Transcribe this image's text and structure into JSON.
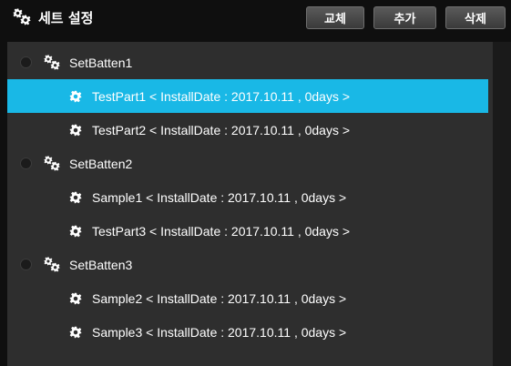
{
  "header": {
    "title": "세트 설정",
    "title_icon": "gears-icon",
    "buttons": {
      "replace": "교체",
      "add": "추가",
      "delete": "삭제"
    }
  },
  "colors": {
    "selected_row": "#19b8e6",
    "panel_bg": "#2e2e2e",
    "page_bg": "#0f0f0f"
  },
  "groups": [
    {
      "label": "SetBatten1",
      "items": [
        {
          "label": "TestPart1 < InstallDate : 2017.10.11 , 0days >",
          "selected": true
        },
        {
          "label": "TestPart2 < InstallDate : 2017.10.11 , 0days >",
          "selected": false
        }
      ]
    },
    {
      "label": "SetBatten2",
      "items": [
        {
          "label": "Sample1 < InstallDate : 2017.10.11 , 0days >",
          "selected": false
        },
        {
          "label": "TestPart3 < InstallDate : 2017.10.11 , 0days >",
          "selected": false
        }
      ]
    },
    {
      "label": "SetBatten3",
      "items": [
        {
          "label": "Sample2 < InstallDate : 2017.10.11 , 0days >",
          "selected": false
        },
        {
          "label": "Sample3 < InstallDate : 2017.10.11 , 0days >",
          "selected": false
        }
      ]
    }
  ]
}
